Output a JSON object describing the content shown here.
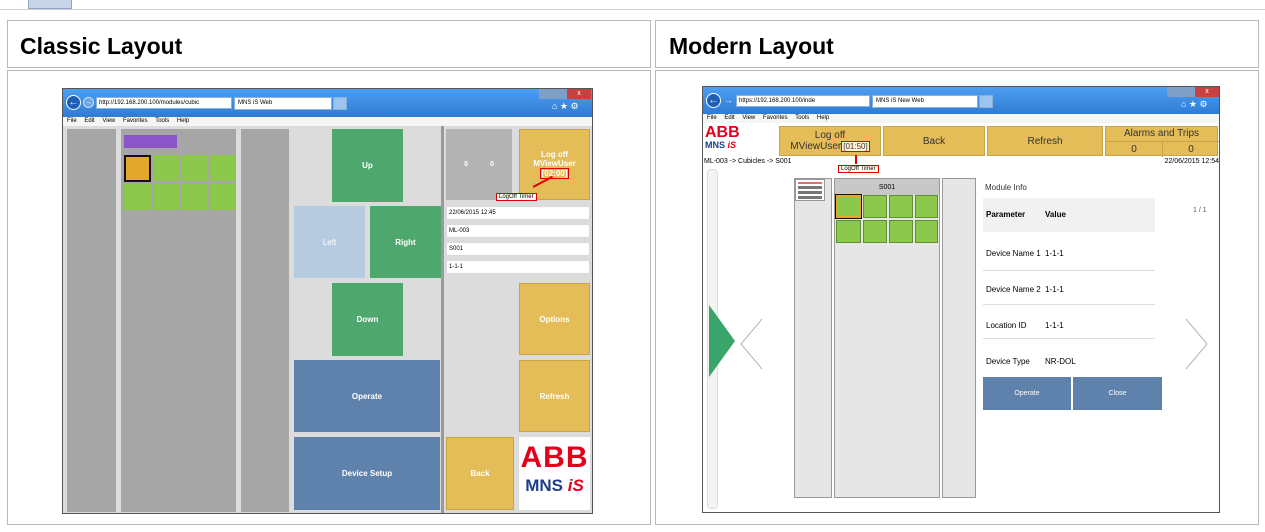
{
  "table": {
    "classic_header": "Classic Layout",
    "modern_header": "Modern Layout"
  },
  "browser_classic": {
    "url": "http://192.168.200.100/modules/cubic",
    "tab": "MNS iS Web",
    "menu": [
      "File",
      "Edit",
      "View",
      "Favorites",
      "Tools",
      "Help"
    ]
  },
  "browser_modern": {
    "url": "https://192.168.200.100/inde",
    "tab": "MNS iS New Web",
    "menu": [
      "File",
      "Edit",
      "View",
      "Favorites",
      "Tools",
      "Help"
    ]
  },
  "classic": {
    "up": "Up",
    "left": "Left",
    "right": "Right",
    "down": "Down",
    "operate": "Operate",
    "device_setup": "Device Setup",
    "counter_a": "0",
    "counter_b": "0",
    "logoff_line1": "Log off",
    "logoff_line2": "MViewUser",
    "logoff_timer": "[02:00]",
    "logoff_tooltip": "LogOff Timer",
    "info": [
      "22/06/2015 12:45",
      "ML-003",
      "S001",
      "1-1-1"
    ],
    "options": "Options",
    "refresh": "Refresh",
    "back": "Back",
    "logo_abb": "ABB",
    "logo_mns": "MNS",
    "logo_is": "iS"
  },
  "modern": {
    "logo_abb": "ABB",
    "logo_mns": "MNS",
    "logo_is": "iS",
    "logoff_line1": "Log off",
    "logoff_user": "MViewUser",
    "logoff_timer": "[01:50]",
    "logoff_tooltip": "LogOff Timer",
    "back": "Back",
    "refresh": "Refresh",
    "alarms_title": "Alarms and Trips",
    "alarms_a": "0",
    "alarms_b": "0",
    "breadcrumb": "ML-003 -> Cubicles -> S001",
    "datetime": "22/06/2015 12:54",
    "cubicle_label": "S001",
    "module_info": "Module Info",
    "col_param": "Parameter",
    "col_value": "Value",
    "page": "1 / 1",
    "rows": [
      {
        "param": "Device Name 1",
        "value": "1-1-1"
      },
      {
        "param": "Device Name 2",
        "value": "1-1-1"
      },
      {
        "param": "Location ID",
        "value": "1-1-1"
      },
      {
        "param": "Device Type",
        "value": "NR-DOL"
      }
    ],
    "operate": "Operate",
    "close": "Close"
  },
  "colors": {
    "gold": "#e4bd59",
    "green": "#4ea86e",
    "slate": "#5f82ad",
    "purple": "#8b55c9",
    "abb_red": "#e2001a"
  }
}
